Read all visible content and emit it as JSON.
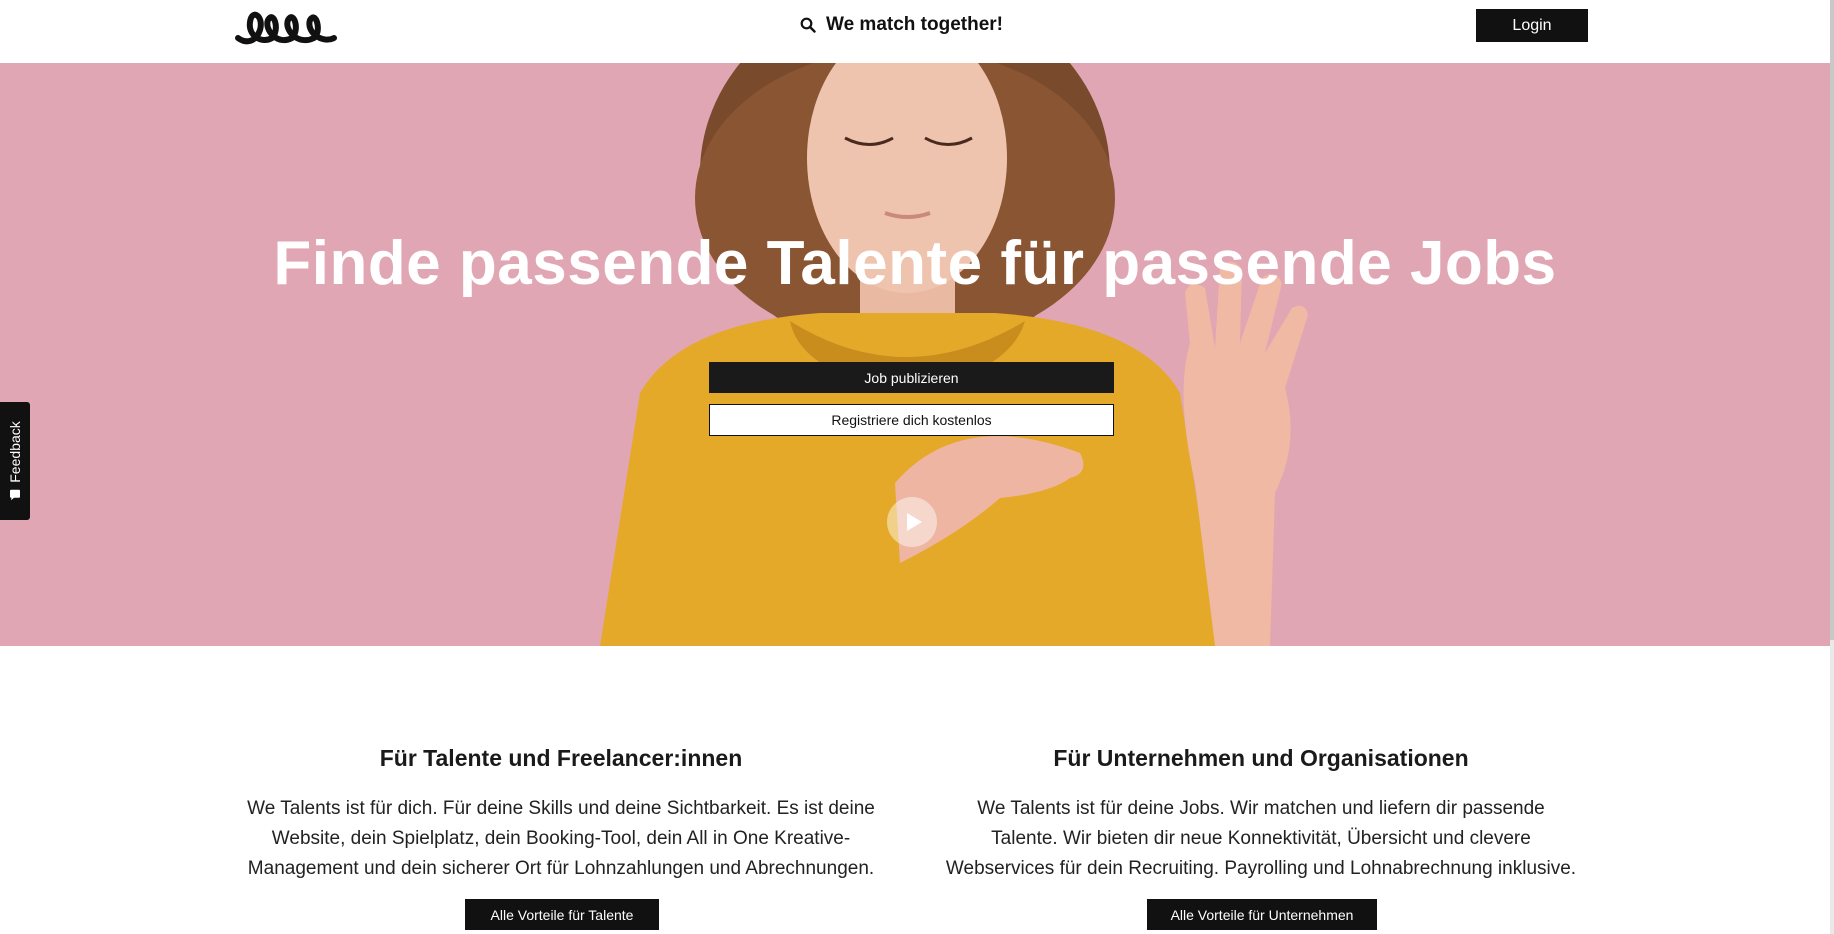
{
  "header": {
    "logo_name": "we-talents-logo",
    "tagline": "We match together!",
    "login_label": "Login"
  },
  "hero": {
    "title": "Finde passende Talente für passende Jobs",
    "publish_label": "Job publizieren",
    "register_label": "Registriere dich kostenlos",
    "background_color": "#e0a6b4"
  },
  "feedback": {
    "label": "Feedback"
  },
  "talents": {
    "heading": "Für Talente und Freelancer:innen",
    "text": "We Talents ist für dich. Für deine Skills und deine Sichtbarkeit. Es ist deine Website, dein Spielplatz, dein Booking-Tool, dein All in One Kreative-Management und dein sicherer Ort für Lohnzahlungen und Abrechnungen.",
    "button_label": "Alle Vorteile für Talente"
  },
  "companies": {
    "heading": "Für Unternehmen und Organisationen",
    "text": "We Talents ist für deine Jobs. Wir matchen und liefern dir passende Talente. Wir bieten dir neue Konnektivität, Übersicht und clevere Webservices für dein Recruiting. Payrolling und Lohnabrechnung inklusive.",
    "button_label": "Alle Vorteile für Unternehmen"
  },
  "colors": {
    "accent": "#111111",
    "hero_bg": "#e0a6b4",
    "hoodie": "#e5a92a"
  }
}
